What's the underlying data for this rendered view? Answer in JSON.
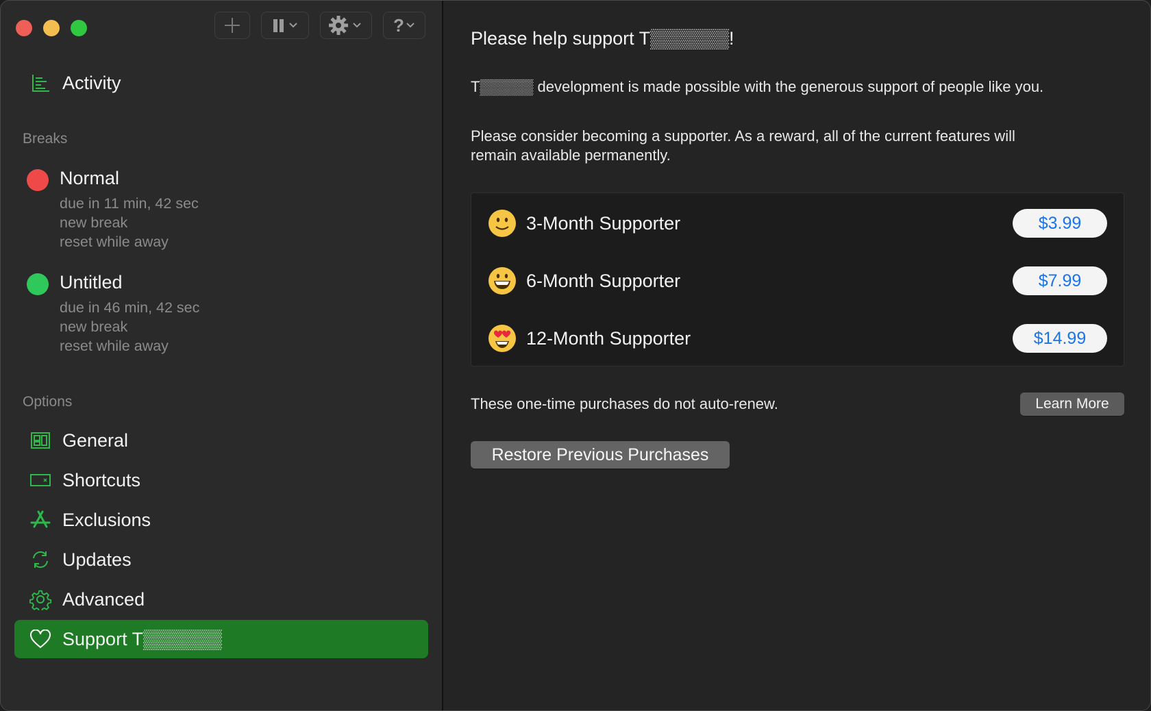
{
  "toolbar": {
    "add_icon": "plus-icon",
    "pause_icon": "pause-icon",
    "settings_icon": "gear-icon",
    "help_icon": "question-icon"
  },
  "sidebar": {
    "activity_label": "Activity",
    "breaks_header": "Breaks",
    "breaks": [
      {
        "name": "Normal",
        "color": "#ef4a4a",
        "line1": "due in 11 min, 42 sec",
        "line2": "new break",
        "line3": "reset while away"
      },
      {
        "name": "Untitled",
        "color": "#2fc85a",
        "line1": "due in 46 min, 42 sec",
        "line2": "new break",
        "line3": "reset while away"
      }
    ],
    "options_header": "Options",
    "options": [
      {
        "label": "General",
        "icon": "general-icon"
      },
      {
        "label": "Shortcuts",
        "icon": "keyboard-icon"
      },
      {
        "label": "Exclusions",
        "icon": "app-store-icon"
      },
      {
        "label": "Updates",
        "icon": "refresh-icon"
      },
      {
        "label": "Advanced",
        "icon": "gear-icon"
      },
      {
        "label": "Support T▒▒▒▒▒▒",
        "icon": "heart-icon"
      }
    ],
    "accent_color": "#1f7a25"
  },
  "content": {
    "heading": "Please help support T▒▒▒▒▒▒!",
    "para1": "T▒▒▒▒▒ development is made possible with the generous support of people like you.",
    "para2": "Please consider becoming a supporter.  As a reward, all of the current features will remain available permanently.",
    "plans": [
      {
        "name": "3-Month Supporter",
        "price": "$3.99",
        "emoji": "slightly-smiling-face"
      },
      {
        "name": "6-Month Supporter",
        "price": "$7.99",
        "emoji": "grinning-face"
      },
      {
        "name": "12-Month Supporter",
        "price": "$14.99",
        "emoji": "heart-eyes-face"
      }
    ],
    "note": "These one-time purchases do not auto-renew.",
    "learn_more": "Learn More",
    "restore": "Restore Previous Purchases",
    "price_color": "#1b74e8"
  }
}
